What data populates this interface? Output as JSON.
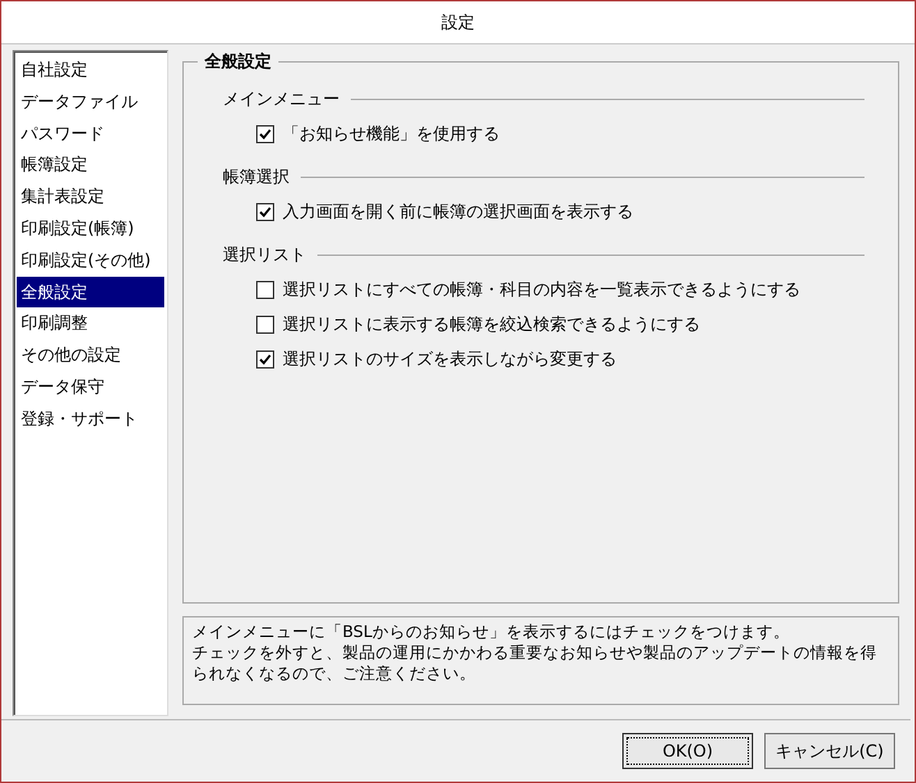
{
  "window": {
    "title": "設定"
  },
  "sidebar": {
    "items": [
      {
        "label": "自社設定",
        "selected": false
      },
      {
        "label": "データファイル",
        "selected": false
      },
      {
        "label": "パスワード",
        "selected": false
      },
      {
        "label": "帳簿設定",
        "selected": false
      },
      {
        "label": "集計表設定",
        "selected": false
      },
      {
        "label": "印刷設定(帳簿)",
        "selected": false
      },
      {
        "label": "印刷設定(その他)",
        "selected": false
      },
      {
        "label": "全般設定",
        "selected": true
      },
      {
        "label": "印刷調整",
        "selected": false
      },
      {
        "label": "その他の設定",
        "selected": false
      },
      {
        "label": "データ保守",
        "selected": false
      },
      {
        "label": "登録・サポート",
        "selected": false
      }
    ]
  },
  "panel": {
    "title": "全般設定",
    "sections": [
      {
        "heading": "メインメニュー",
        "options": [
          {
            "label": "「お知らせ機能」を使用する",
            "checked": true
          }
        ]
      },
      {
        "heading": "帳簿選択",
        "options": [
          {
            "label": "入力画面を開く前に帳簿の選択画面を表示する",
            "checked": true
          }
        ]
      },
      {
        "heading": "選択リスト",
        "options": [
          {
            "label": "選択リストにすべての帳簿・科目の内容を一覧表示できるようにする",
            "checked": false
          },
          {
            "label": "選択リストに表示する帳簿を絞込検索できるようにする",
            "checked": false
          },
          {
            "label": "選択リストのサイズを表示しながら変更する",
            "checked": true
          }
        ]
      }
    ]
  },
  "help": {
    "lines": [
      "メインメニューに「BSLからのお知らせ」を表示するにはチェックをつけます。",
      "チェックを外すと、製品の運用にかかわる重要なお知らせや製品のアップデートの情報を得られなくなるので、ご注意ください。"
    ]
  },
  "buttons": [
    {
      "label": "OK(O)",
      "kind": "default"
    },
    {
      "label": "キャンセル(C)",
      "kind": "normal"
    }
  ]
}
